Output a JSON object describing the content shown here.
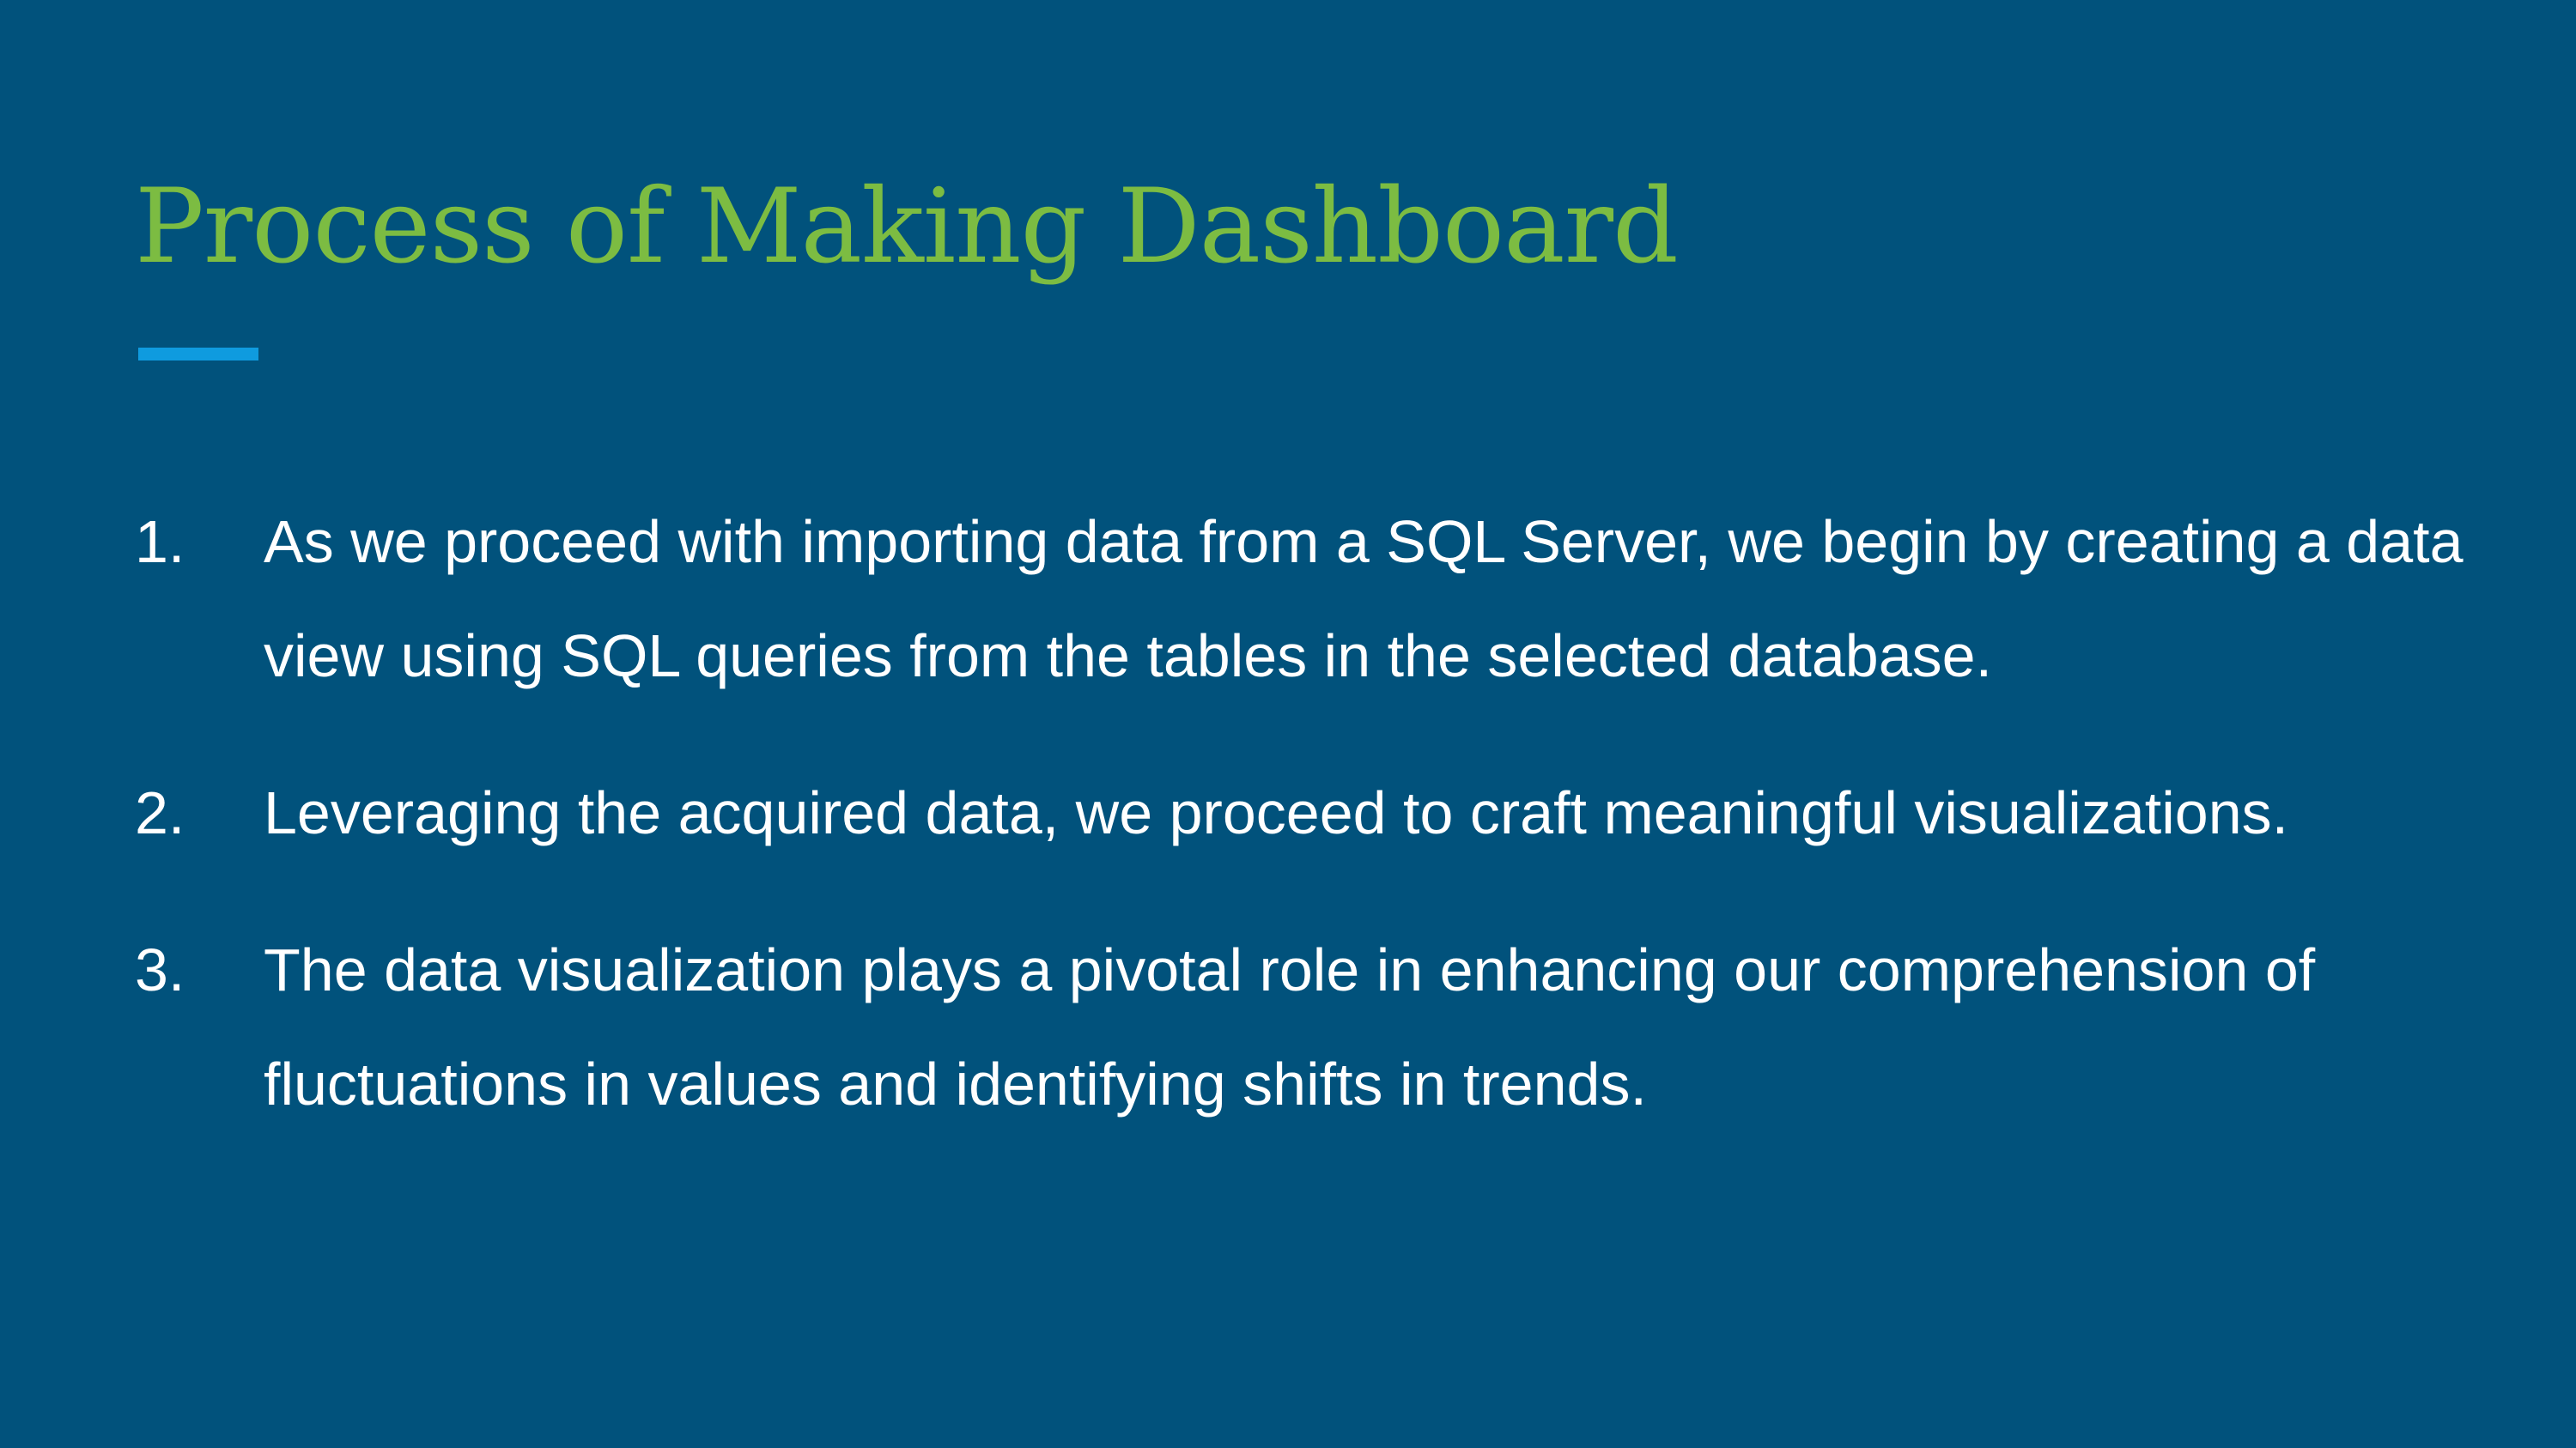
{
  "slide": {
    "title": "Process of Making Dashboard",
    "items": [
      {
        "number": "1.",
        "text": "As we proceed with importing data from a SQL Server, we begin by creating a data view using SQL queries from the tables in the selected database."
      },
      {
        "number": "2.",
        "text": "Leveraging the acquired data, we proceed to craft meaningful visualizations."
      },
      {
        "number": "3.",
        "text": "The data visualization plays a pivotal role in enhancing our comprehension of fluctuations in values and identifying shifts in trends."
      }
    ]
  },
  "colors": {
    "background": "#01527c",
    "title": "#7cbc42",
    "accent": "#0f9bdf",
    "body_text": "#ffffff"
  }
}
